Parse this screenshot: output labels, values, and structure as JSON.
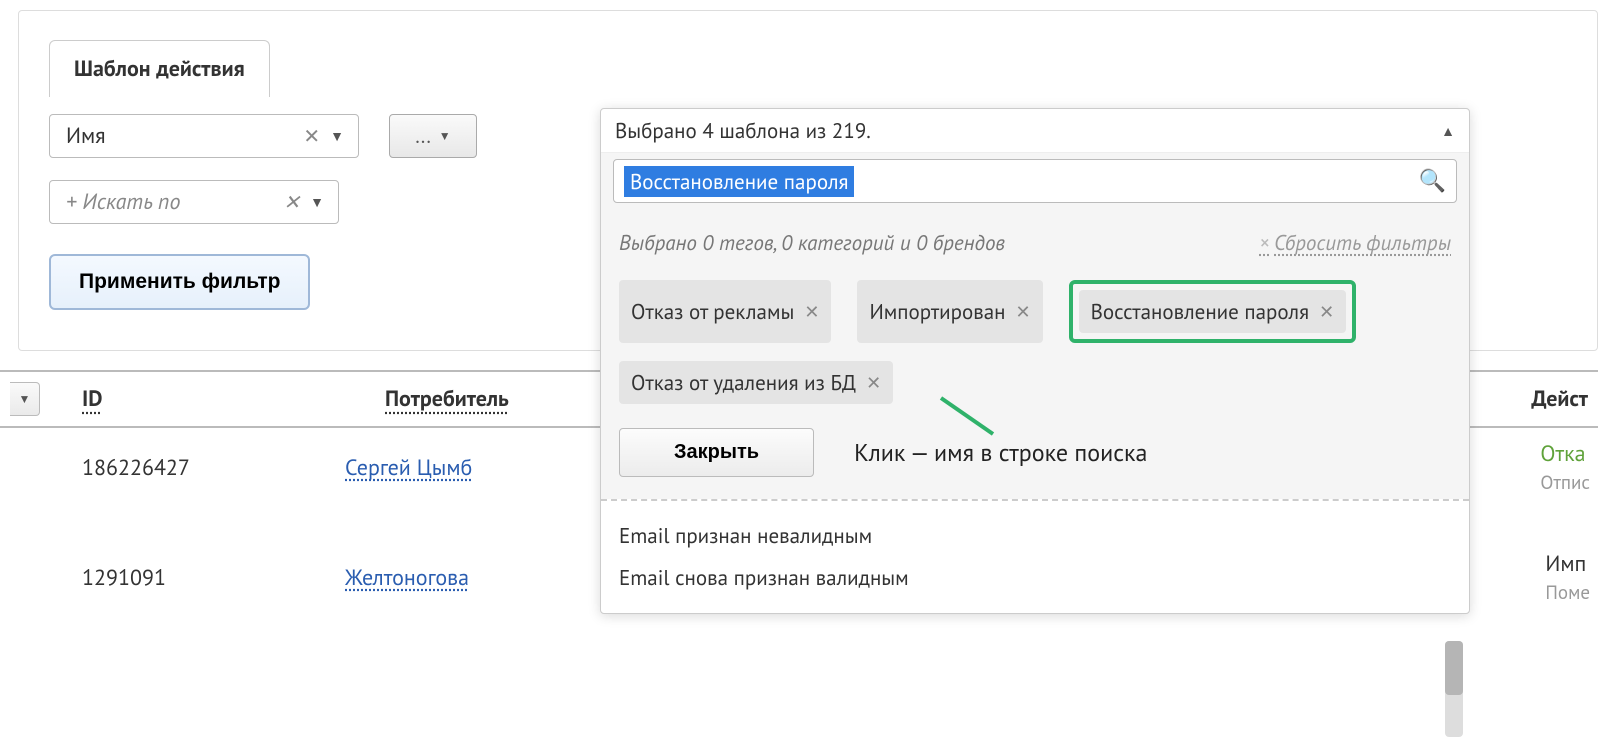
{
  "tab": {
    "label": "Шаблон действия"
  },
  "filter": {
    "field": {
      "label": "Имя"
    },
    "ops": {
      "label": "..."
    },
    "searchBy": {
      "placeholder": "+ Искать по"
    },
    "apply": {
      "label": "Применить фильтр"
    }
  },
  "dropdown": {
    "header": "Выбрано 4 шаблона из 219.",
    "searchValue": "Восстановление пароля",
    "tagsInfo": "Выбрано 0 тегов, 0 категорий и 0 брендов",
    "resetLabel": "Сбросить фильтры",
    "chips": [
      {
        "label": "Отказ от рекламы"
      },
      {
        "label": "Импортирован"
      },
      {
        "label": "Восстановление пароля",
        "highlighted": true
      },
      {
        "label": "Отказ от удаления из БД"
      }
    ],
    "closeLabel": "Закрыть",
    "annotation": "Клик — имя в строке поиска",
    "list": [
      "Email признан невалидным",
      "Email снова признан валидным"
    ]
  },
  "table": {
    "headers": {
      "id": "ID",
      "consumer": "Потребитель",
      "action": "Дейст"
    },
    "rows": [
      {
        "id": "186226427",
        "consumer": "Сергей Цымб",
        "status1": "Отка",
        "status2": "Отпис"
      },
      {
        "id": "1291091",
        "consumer": "Желтоногова ",
        "status1": "Имп",
        "status2": "Поме"
      }
    ]
  }
}
